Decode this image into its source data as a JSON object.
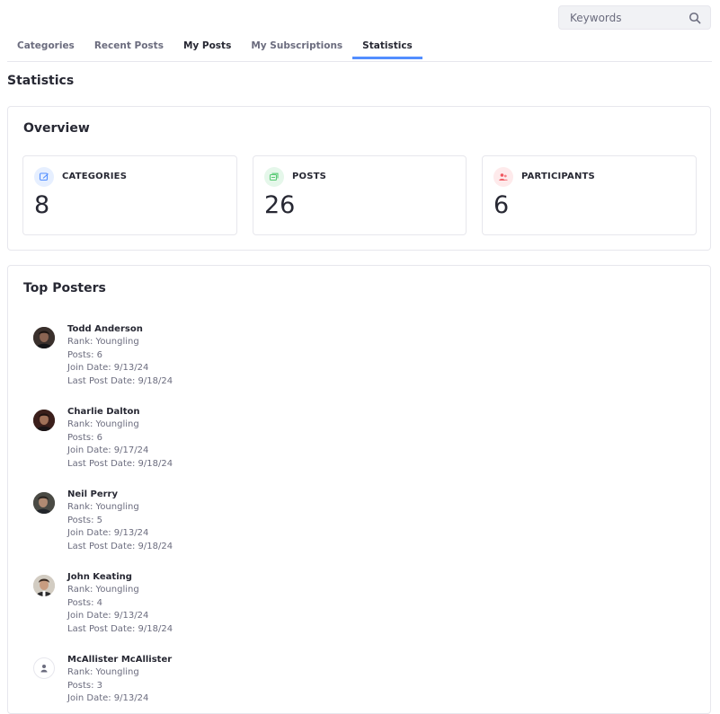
{
  "search": {
    "placeholder": "Keywords",
    "icon": "search-icon"
  },
  "tabs": [
    {
      "label": "Categories"
    },
    {
      "label": "Recent Posts"
    },
    {
      "label": "My Posts"
    },
    {
      "label": "My Subscriptions"
    },
    {
      "label": "Statistics",
      "active": true
    }
  ],
  "page_title": "Statistics",
  "overview": {
    "title": "Overview",
    "cards": [
      {
        "label": "CATEGORIES",
        "value": "8",
        "icon": "categories-icon",
        "color": "#528eff"
      },
      {
        "label": "POSTS",
        "value": "26",
        "icon": "posts-icon",
        "color": "#5aca75"
      },
      {
        "label": "PARTICIPANTS",
        "value": "6",
        "icon": "participants-icon",
        "color": "#f0565e"
      }
    ]
  },
  "top_posters": {
    "title": "Top Posters",
    "posters": [
      {
        "name": "Todd Anderson",
        "rank": "Rank: Youngling",
        "posts": "Posts: 6",
        "join": "Join Date: 9/13/24",
        "last": "Last Post Date: 9/18/24"
      },
      {
        "name": "Charlie Dalton",
        "rank": "Rank: Youngling",
        "posts": "Posts: 6",
        "join": "Join Date: 9/17/24",
        "last": "Last Post Date: 9/18/24"
      },
      {
        "name": "Neil Perry",
        "rank": "Rank: Youngling",
        "posts": "Posts: 5",
        "join": "Join Date: 9/13/24",
        "last": "Last Post Date: 9/18/24"
      },
      {
        "name": "John Keating",
        "rank": "Rank: Youngling",
        "posts": "Posts: 4",
        "join": "Join Date: 9/13/24",
        "last": "Last Post Date: 9/18/24"
      },
      {
        "name": "McAllister McAllister",
        "rank": "Rank: Youngling",
        "posts": "Posts: 3",
        "join": "Join Date: 9/13/24"
      }
    ]
  },
  "colors": {
    "accent": "#528eff",
    "text": "#272833",
    "muted": "#6b6c7e",
    "border": "#e7e7ed"
  }
}
